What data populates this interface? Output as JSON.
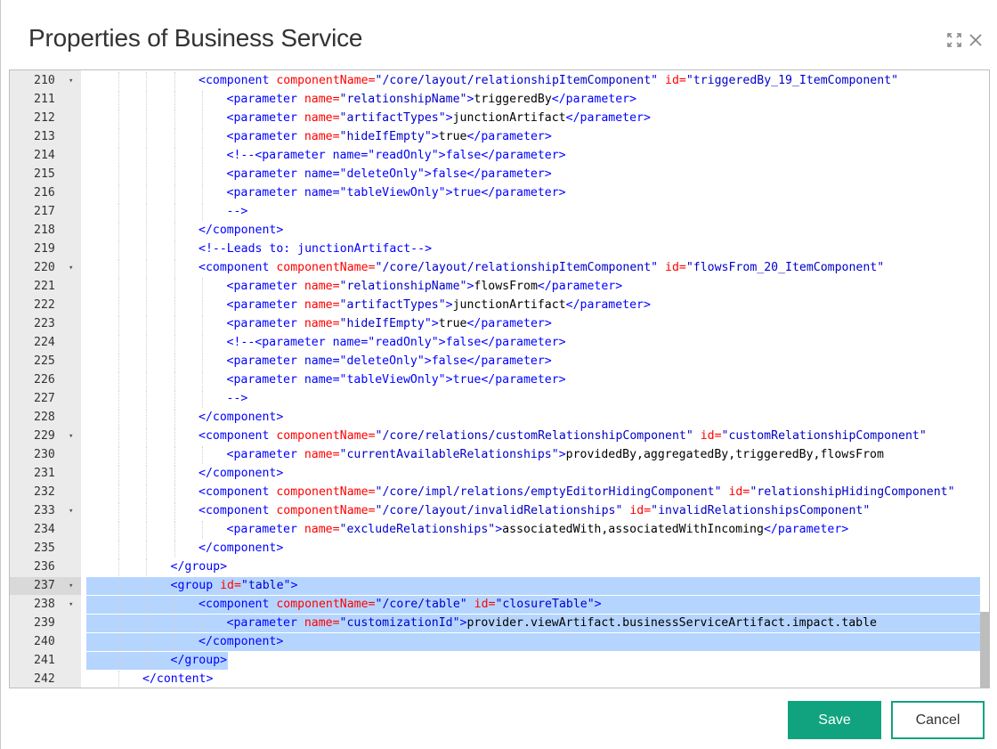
{
  "dialog": {
    "title": "Properties of Business Service",
    "expand_icon": "expand-icon",
    "close_icon": "close-icon"
  },
  "editor": {
    "lines": [
      {
        "n": "210",
        "fold": true,
        "indent": 4,
        "tokens": [
          [
            "t",
            "<component "
          ],
          [
            "a",
            "componentName="
          ],
          [
            "v",
            "\"/core/layout/relationshipItemComponent\""
          ],
          [
            "a",
            " id="
          ],
          [
            "v",
            "\"triggeredBy_19_ItemComponent\""
          ]
        ]
      },
      {
        "n": "211",
        "fold": false,
        "indent": 5,
        "tokens": [
          [
            "t",
            "<parameter "
          ],
          [
            "a",
            "name="
          ],
          [
            "v",
            "\"relationshipName\""
          ],
          [
            "t",
            ">"
          ],
          [
            "x",
            "triggeredBy"
          ],
          [
            "t",
            "</parameter>"
          ]
        ]
      },
      {
        "n": "212",
        "fold": false,
        "indent": 5,
        "tokens": [
          [
            "t",
            "<parameter "
          ],
          [
            "a",
            "name="
          ],
          [
            "v",
            "\"artifactTypes\""
          ],
          [
            "t",
            ">"
          ],
          [
            "x",
            "junctionArtifact"
          ],
          [
            "t",
            "</parameter>"
          ]
        ]
      },
      {
        "n": "213",
        "fold": false,
        "indent": 5,
        "tokens": [
          [
            "t",
            "<parameter "
          ],
          [
            "a",
            "name="
          ],
          [
            "v",
            "\"hideIfEmpty\""
          ],
          [
            "t",
            ">"
          ],
          [
            "x",
            "true"
          ],
          [
            "t",
            "</parameter>"
          ]
        ]
      },
      {
        "n": "214",
        "fold": false,
        "indent": 5,
        "tokens": [
          [
            "c",
            "<!--<parameter name=\"readOnly\">false</parameter>"
          ]
        ]
      },
      {
        "n": "215",
        "fold": false,
        "indent": 5,
        "tokens": [
          [
            "c",
            "<parameter name=\"deleteOnly\">false</parameter>"
          ]
        ]
      },
      {
        "n": "216",
        "fold": false,
        "indent": 5,
        "tokens": [
          [
            "c",
            "<parameter name=\"tableViewOnly\">true</parameter>"
          ]
        ]
      },
      {
        "n": "217",
        "fold": false,
        "indent": 5,
        "tokens": [
          [
            "c",
            "-->"
          ]
        ]
      },
      {
        "n": "218",
        "fold": false,
        "indent": 4,
        "tokens": [
          [
            "t",
            "</component>"
          ]
        ]
      },
      {
        "n": "219",
        "fold": false,
        "indent": 4,
        "tokens": [
          [
            "c",
            "<!--Leads to: junctionArtifact-->"
          ]
        ]
      },
      {
        "n": "220",
        "fold": true,
        "indent": 4,
        "tokens": [
          [
            "t",
            "<component "
          ],
          [
            "a",
            "componentName="
          ],
          [
            "v",
            "\"/core/layout/relationshipItemComponent\""
          ],
          [
            "a",
            " id="
          ],
          [
            "v",
            "\"flowsFrom_20_ItemComponent\""
          ]
        ]
      },
      {
        "n": "221",
        "fold": false,
        "indent": 5,
        "tokens": [
          [
            "t",
            "<parameter "
          ],
          [
            "a",
            "name="
          ],
          [
            "v",
            "\"relationshipName\""
          ],
          [
            "t",
            ">"
          ],
          [
            "x",
            "flowsFrom"
          ],
          [
            "t",
            "</parameter>"
          ]
        ]
      },
      {
        "n": "222",
        "fold": false,
        "indent": 5,
        "tokens": [
          [
            "t",
            "<parameter "
          ],
          [
            "a",
            "name="
          ],
          [
            "v",
            "\"artifactTypes\""
          ],
          [
            "t",
            ">"
          ],
          [
            "x",
            "junctionArtifact"
          ],
          [
            "t",
            "</parameter>"
          ]
        ]
      },
      {
        "n": "223",
        "fold": false,
        "indent": 5,
        "tokens": [
          [
            "t",
            "<parameter "
          ],
          [
            "a",
            "name="
          ],
          [
            "v",
            "\"hideIfEmpty\""
          ],
          [
            "t",
            ">"
          ],
          [
            "x",
            "true"
          ],
          [
            "t",
            "</parameter>"
          ]
        ]
      },
      {
        "n": "224",
        "fold": false,
        "indent": 5,
        "tokens": [
          [
            "c",
            "<!--<parameter name=\"readOnly\">false</parameter>"
          ]
        ]
      },
      {
        "n": "225",
        "fold": false,
        "indent": 5,
        "tokens": [
          [
            "c",
            "<parameter name=\"deleteOnly\">false</parameter>"
          ]
        ]
      },
      {
        "n": "226",
        "fold": false,
        "indent": 5,
        "tokens": [
          [
            "c",
            "<parameter name=\"tableViewOnly\">true</parameter>"
          ]
        ]
      },
      {
        "n": "227",
        "fold": false,
        "indent": 5,
        "tokens": [
          [
            "c",
            "-->"
          ]
        ]
      },
      {
        "n": "228",
        "fold": false,
        "indent": 4,
        "tokens": [
          [
            "t",
            "</component>"
          ]
        ]
      },
      {
        "n": "229",
        "fold": true,
        "indent": 4,
        "tokens": [
          [
            "t",
            "<component "
          ],
          [
            "a",
            "componentName="
          ],
          [
            "v",
            "\"/core/relations/customRelationshipComponent\""
          ],
          [
            "a",
            " id="
          ],
          [
            "v",
            "\"customRelationshipComponent\""
          ]
        ]
      },
      {
        "n": "230",
        "fold": false,
        "indent": 5,
        "tokens": [
          [
            "t",
            "<parameter "
          ],
          [
            "a",
            "name="
          ],
          [
            "v",
            "\"currentAvailableRelationships\""
          ],
          [
            "t",
            ">"
          ],
          [
            "x",
            "providedBy,aggregatedBy,triggeredBy,flowsFrom"
          ]
        ]
      },
      {
        "n": "231",
        "fold": false,
        "indent": 4,
        "tokens": [
          [
            "t",
            "</component>"
          ]
        ]
      },
      {
        "n": "232",
        "fold": false,
        "indent": 4,
        "tokens": [
          [
            "t",
            "<component "
          ],
          [
            "a",
            "componentName="
          ],
          [
            "v",
            "\"/core/impl/relations/emptyEditorHidingComponent\""
          ],
          [
            "a",
            " id="
          ],
          [
            "v",
            "\"relationshipHidingComponent\""
          ]
        ]
      },
      {
        "n": "233",
        "fold": true,
        "indent": 4,
        "tokens": [
          [
            "t",
            "<component "
          ],
          [
            "a",
            "componentName="
          ],
          [
            "v",
            "\"/core/layout/invalidRelationships\""
          ],
          [
            "a",
            " id="
          ],
          [
            "v",
            "\"invalidRelationshipsComponent\""
          ]
        ]
      },
      {
        "n": "234",
        "fold": false,
        "indent": 5,
        "tokens": [
          [
            "t",
            "<parameter "
          ],
          [
            "a",
            "name="
          ],
          [
            "v",
            "\"excludeRelationships\""
          ],
          [
            "t",
            ">"
          ],
          [
            "x",
            "associatedWith,associatedWithIncoming"
          ],
          [
            "t",
            "</parameter>"
          ]
        ]
      },
      {
        "n": "235",
        "fold": false,
        "indent": 4,
        "tokens": [
          [
            "t",
            "</component>"
          ]
        ]
      },
      {
        "n": "236",
        "fold": false,
        "indent": 3,
        "tokens": [
          [
            "t",
            "</group>"
          ]
        ]
      },
      {
        "n": "237",
        "fold": true,
        "indent": 3,
        "active": true,
        "sel": "full",
        "tokens": [
          [
            "t",
            "<group "
          ],
          [
            "a",
            "id="
          ],
          [
            "v",
            "\"table\""
          ],
          [
            "t",
            ">"
          ]
        ]
      },
      {
        "n": "238",
        "fold": true,
        "indent": 4,
        "sel": "full",
        "tokens": [
          [
            "t",
            "<component "
          ],
          [
            "a",
            "componentName="
          ],
          [
            "v",
            "\"/core/table\""
          ],
          [
            "a",
            " id="
          ],
          [
            "v",
            "\"closureTable\""
          ],
          [
            "t",
            ">"
          ]
        ]
      },
      {
        "n": "239",
        "fold": false,
        "indent": 5,
        "sel": "full",
        "tokens": [
          [
            "t",
            "<parameter "
          ],
          [
            "a",
            "name="
          ],
          [
            "v",
            "\"customizationId\""
          ],
          [
            "t",
            ">"
          ],
          [
            "x",
            "provider.viewArtifact.businessServiceArtifact.impact.table"
          ]
        ]
      },
      {
        "n": "240",
        "fold": false,
        "indent": 4,
        "sel": "full",
        "tokens": [
          [
            "t",
            "</component>"
          ]
        ]
      },
      {
        "n": "241",
        "fold": false,
        "indent": 3,
        "sel": "partial",
        "tokens": [
          [
            "t",
            "</group>"
          ]
        ]
      },
      {
        "n": "242",
        "fold": false,
        "indent": 2,
        "tokens": [
          [
            "t",
            "</content>"
          ]
        ]
      }
    ]
  },
  "footer": {
    "save_label": "Save",
    "cancel_label": "Cancel"
  },
  "colors": {
    "accent": "#11a37f",
    "selection": "#b5d5ff",
    "tag": "#0000ff",
    "attribute": "#ff0000",
    "value": "#0000cc"
  }
}
